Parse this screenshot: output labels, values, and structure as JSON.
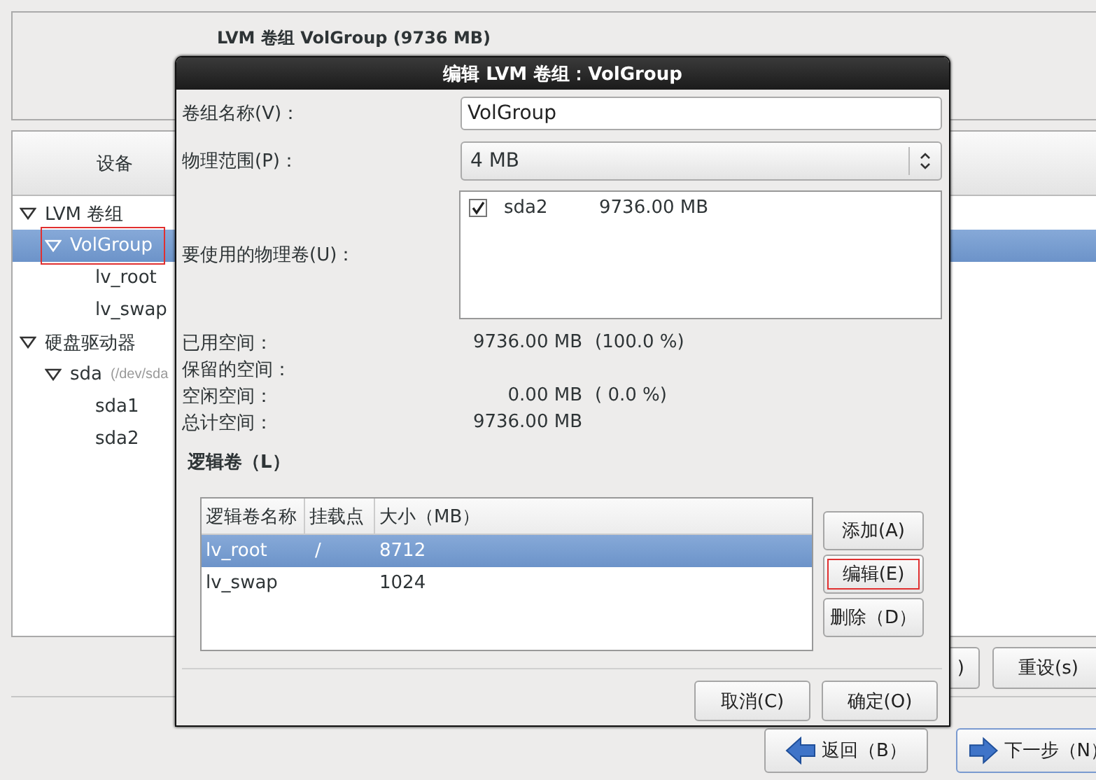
{
  "background": {
    "group_title": "LVM 卷组 VolGroup (9736 MB)",
    "device_header": "设备",
    "tree": [
      {
        "label": "LVM 卷组",
        "expanded": true,
        "selected": false,
        "annotated": false,
        "children": [
          {
            "label": "VolGroup",
            "expanded": true,
            "selected": true,
            "annotated": true,
            "children": [
              {
                "label": "lv_root",
                "selected": false,
                "annotated": false
              },
              {
                "label": "lv_swap",
                "selected": false,
                "annotated": false
              }
            ]
          }
        ]
      },
      {
        "label": "硬盘驱动器",
        "expanded": true,
        "selected": false,
        "annotated": false,
        "children": [
          {
            "label": "sda",
            "detail": "(/dev/sda",
            "expanded": true,
            "selected": false,
            "annotated": false,
            "children": [
              {
                "label": "sda1",
                "selected": false,
                "annotated": false
              },
              {
                "label": "sda2",
                "selected": false,
                "annotated": false
              }
            ]
          }
        ]
      }
    ],
    "buttons": [
      ")",
      "重设(s)"
    ],
    "nav_buttons": [
      {
        "label": "返回（B）",
        "kind": "back"
      },
      {
        "label": "下一步（N）",
        "kind": "next"
      }
    ]
  },
  "dialog": {
    "title": "编辑 LVM 卷组：VolGroup",
    "name_label": "卷组名称(V)：",
    "name_value": "VolGroup",
    "extent_label": "物理范围(P)：",
    "extent_value": "4 MB",
    "pv_label": "要使用的物理卷(U)：",
    "physical_volumes": [
      {
        "name": "sda2",
        "size": "9736.00 MB",
        "checked": true
      }
    ],
    "stats": [
      {
        "label": "已用空间：",
        "amount": "9736.00 MB",
        "percent": "(100.0 %)"
      },
      {
        "label": "保留的空间："
      },
      {
        "label": "空闲空间：",
        "amount": "0.00 MB",
        "percent": "( 0.0 %)"
      },
      {
        "label": "总计空间：",
        "amount": "9736.00 MB"
      }
    ],
    "lv_title": "逻辑卷（L）",
    "lv_columns": [
      "逻辑卷名称",
      "挂载点",
      "大小（MB）"
    ],
    "lv_rows": [
      {
        "cells": [
          "lv_root",
          "/",
          "8712"
        ],
        "selected": true
      },
      {
        "cells": [
          "lv_swap",
          "",
          "1024"
        ],
        "selected": false
      }
    ],
    "lv_buttons": [
      {
        "label": "添加(A)",
        "annotated": false
      },
      {
        "label": "编辑(E)",
        "annotated": true
      },
      {
        "label": "删除（D）",
        "annotated": false
      }
    ],
    "footer_buttons": [
      "取消(C)",
      "确定(O)"
    ]
  }
}
